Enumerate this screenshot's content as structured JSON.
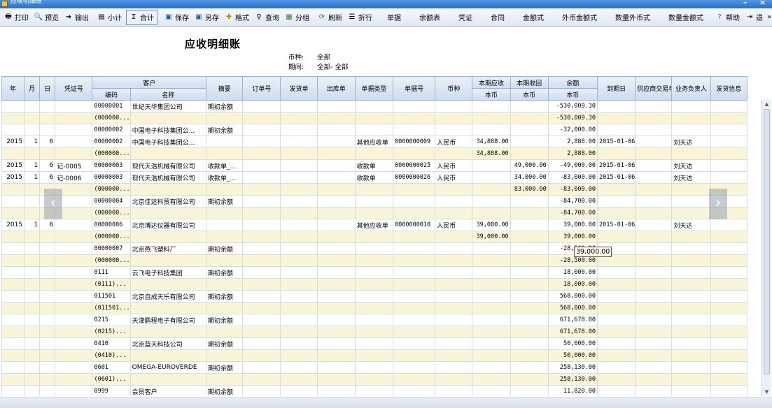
{
  "window": {
    "title": "应收明细账"
  },
  "toolbar": {
    "buttons": [
      {
        "label": "打印",
        "icon": "printer-icon"
      },
      {
        "label": "预览",
        "icon": "preview-icon"
      },
      {
        "label": "输出",
        "icon": "export-icon"
      },
      {
        "label": "小计",
        "icon": "subtotal-icon"
      },
      {
        "label": "合计",
        "icon": "sigma-icon"
      },
      {
        "label": "保存",
        "icon": "save-icon"
      },
      {
        "label": "另存",
        "icon": "save-as-icon"
      },
      {
        "label": "格式",
        "icon": "format-icon"
      },
      {
        "label": "查询",
        "icon": "binoculars-icon"
      },
      {
        "label": "分组",
        "icon": "group-icon"
      },
      {
        "label": "刷新",
        "icon": "refresh-icon"
      },
      {
        "label": "折行",
        "icon": "wrap-icon"
      },
      {
        "label": "单据"
      },
      {
        "label": "余额表"
      },
      {
        "label": "凭证"
      },
      {
        "label": "合同"
      },
      {
        "label": "金额式"
      },
      {
        "label": "外币金额式"
      },
      {
        "label": "数量外币式"
      },
      {
        "label": "数量金额式"
      },
      {
        "label": "帮助",
        "icon": "help-icon"
      },
      {
        "label": "退",
        "icon": "exit-icon"
      }
    ]
  },
  "report": {
    "title": "应收明细账",
    "currency_label": "币种:",
    "currency_value": "全部",
    "period_label": "期间:",
    "period_value": "全部- 全部"
  },
  "grid": {
    "headers": {
      "year": "年",
      "month": "月",
      "day": "日",
      "voucher": "凭证号",
      "customer": "客户",
      "code": "编码",
      "name": "名称",
      "summary": "摘要",
      "order": "订单号",
      "delivery": "发货单",
      "outbound": "出库单",
      "doc_type": "单据类型",
      "doc_no": "单据号",
      "currency": "币种",
      "receivable": "本期应收",
      "received": "本期收回",
      "balance": "余额",
      "base_currency": "本币",
      "due_date": "到期日",
      "supplier_doc": "供应商交易单号",
      "salesperson": "业务负责人",
      "shipping": "发货信息"
    },
    "rows": [
      {
        "sub": false,
        "y": "",
        "m": "",
        "d": "",
        "v": "",
        "code": "00000001",
        "name": "世纪天华集团公司",
        "sum": "期初余额",
        "dt": "",
        "dn": "",
        "cur": "",
        "rec": "",
        "rcv": "",
        "bal": "-530,009.30",
        "due": "",
        "sp": ""
      },
      {
        "sub": true,
        "y": "",
        "m": "",
        "d": "",
        "v": "",
        "code": "(000000...",
        "name": "",
        "sum": "",
        "dt": "",
        "dn": "",
        "cur": "",
        "rec": "",
        "rcv": "",
        "bal": "-530,009.30",
        "due": "",
        "sp": ""
      },
      {
        "sub": false,
        "y": "",
        "m": "",
        "d": "",
        "v": "",
        "code": "00000002",
        "name": "中国电子科技集团公...",
        "sum": "期初余额",
        "dt": "",
        "dn": "",
        "cur": "",
        "rec": "",
        "rcv": "",
        "bal": "-32,000.00",
        "due": "",
        "sp": ""
      },
      {
        "sub": false,
        "y": "2015",
        "m": "1",
        "d": "6",
        "v": "",
        "code": "00000002",
        "name": "中国电子科技集团公...",
        "sum": "",
        "dt": "其他应收单",
        "dn": "0000000009",
        "cur": "人民币",
        "rec": "34,888.00",
        "rcv": "",
        "bal": "2,888.00",
        "due": "2015-01-06",
        "sp": "刘天达"
      },
      {
        "sub": true,
        "y": "",
        "m": "",
        "d": "",
        "v": "",
        "code": "(000000...",
        "name": "",
        "sum": "",
        "dt": "",
        "dn": "",
        "cur": "",
        "rec": "34,888.00",
        "rcv": "",
        "bal": "2,888.00",
        "due": "",
        "sp": ""
      },
      {
        "sub": false,
        "y": "2015",
        "m": "1",
        "d": "6",
        "v": "记-0005",
        "code": "00000003",
        "name": "现代天浩机械有限公司",
        "sum": "收款单_...",
        "dt": "收款单",
        "dn": "0000000025",
        "cur": "人民币",
        "rec": "",
        "rcv": "49,000.00",
        "bal": "-49,000.00",
        "due": "2015-01-06",
        "sp": "刘天达"
      },
      {
        "sub": false,
        "y": "2015",
        "m": "1",
        "d": "6",
        "v": "记-0006",
        "code": "00000003",
        "name": "现代天浩机械有限公司",
        "sum": "收款单_...",
        "dt": "收款单",
        "dn": "0000000026",
        "cur": "人民币",
        "rec": "",
        "rcv": "34,000.00",
        "bal": "-83,000.00",
        "due": "2015-01-06",
        "sp": "刘天达"
      },
      {
        "sub": true,
        "y": "",
        "m": "",
        "d": "",
        "v": "",
        "code": "(000000...",
        "name": "",
        "sum": "",
        "dt": "",
        "dn": "",
        "cur": "",
        "rec": "",
        "rcv": "83,000.00",
        "bal": "-83,000.00",
        "due": "",
        "sp": ""
      },
      {
        "sub": false,
        "y": "",
        "m": "",
        "d": "",
        "v": "",
        "code": "00000004",
        "name": "北京佳运科贸有限公司",
        "sum": "期初余额",
        "dt": "",
        "dn": "",
        "cur": "",
        "rec": "",
        "rcv": "",
        "bal": "-84,700.00",
        "due": "",
        "sp": ""
      },
      {
        "sub": true,
        "y": "",
        "m": "",
        "d": "",
        "v": "",
        "code": "(000000...",
        "name": "",
        "sum": "",
        "dt": "",
        "dn": "",
        "cur": "",
        "rec": "",
        "rcv": "",
        "bal": "-84,700.00",
        "due": "",
        "sp": ""
      },
      {
        "sub": false,
        "y": "2015",
        "m": "1",
        "d": "6",
        "v": "",
        "code": "00000006",
        "name": "北京博达仪器有限公司",
        "sum": "",
        "dt": "其他应收单",
        "dn": "0000000010",
        "cur": "人民币",
        "rec": "39,000.00",
        "rcv": "",
        "bal": "39,000.00",
        "due": "2015-01-06",
        "sp": "刘天达"
      },
      {
        "sub": true,
        "y": "",
        "m": "",
        "d": "",
        "v": "",
        "code": "(000000...",
        "name": "",
        "sum": "",
        "dt": "",
        "dn": "",
        "cur": "",
        "rec": "39,000.00",
        "rcv": "",
        "bal": "39,000.00",
        "due": "",
        "sp": ""
      },
      {
        "sub": false,
        "y": "",
        "m": "",
        "d": "",
        "v": "",
        "code": "00000007",
        "name": "北京燕飞塑料厂",
        "sum": "期初余额",
        "dt": "",
        "dn": "",
        "cur": "",
        "rec": "",
        "rcv": "",
        "bal": "-28,500.00",
        "due": "",
        "sp": ""
      },
      {
        "sub": true,
        "y": "",
        "m": "",
        "d": "",
        "v": "",
        "code": "(000000...",
        "name": "",
        "sum": "",
        "dt": "",
        "dn": "",
        "cur": "",
        "rec": "",
        "rcv": "",
        "bal": "-28,500.00",
        "due": "",
        "sp": ""
      },
      {
        "sub": false,
        "y": "",
        "m": "",
        "d": "",
        "v": "",
        "code": "0111",
        "name": "云飞电子科技集团",
        "sum": "期初余额",
        "dt": "",
        "dn": "",
        "cur": "",
        "rec": "",
        "rcv": "",
        "bal": "18,000.00",
        "due": "",
        "sp": ""
      },
      {
        "sub": true,
        "y": "",
        "m": "",
        "d": "",
        "v": "",
        "code": "(0111)...",
        "name": "",
        "sum": "",
        "dt": "",
        "dn": "",
        "cur": "",
        "rec": "",
        "rcv": "",
        "bal": "18,000.00",
        "due": "",
        "sp": ""
      },
      {
        "sub": false,
        "y": "",
        "m": "",
        "d": "",
        "v": "",
        "code": "011501",
        "name": "北京自成天乐有限公司",
        "sum": "期初余额",
        "dt": "",
        "dn": "",
        "cur": "",
        "rec": "",
        "rcv": "",
        "bal": "568,000.00",
        "due": "",
        "sp": ""
      },
      {
        "sub": true,
        "y": "",
        "m": "",
        "d": "",
        "v": "",
        "code": "(011501...",
        "name": "",
        "sum": "",
        "dt": "",
        "dn": "",
        "cur": "",
        "rec": "",
        "rcv": "",
        "bal": "568,000.00",
        "due": "",
        "sp": ""
      },
      {
        "sub": false,
        "y": "",
        "m": "",
        "d": "",
        "v": "",
        "code": "0215",
        "name": "天津鹏程电子有限公司",
        "sum": "期初余额",
        "dt": "",
        "dn": "",
        "cur": "",
        "rec": "",
        "rcv": "",
        "bal": "671,678.00",
        "due": "",
        "sp": ""
      },
      {
        "sub": true,
        "y": "",
        "m": "",
        "d": "",
        "v": "",
        "code": "(0215)...",
        "name": "",
        "sum": "",
        "dt": "",
        "dn": "",
        "cur": "",
        "rec": "",
        "rcv": "",
        "bal": "671,678.00",
        "due": "",
        "sp": ""
      },
      {
        "sub": false,
        "y": "",
        "m": "",
        "d": "",
        "v": "",
        "code": "0410",
        "name": "北京蓝天科技公司",
        "sum": "期初余额",
        "dt": "",
        "dn": "",
        "cur": "",
        "rec": "",
        "rcv": "",
        "bal": "50,000.00",
        "due": "",
        "sp": ""
      },
      {
        "sub": true,
        "y": "",
        "m": "",
        "d": "",
        "v": "",
        "code": "(0410)...",
        "name": "",
        "sum": "",
        "dt": "",
        "dn": "",
        "cur": "",
        "rec": "",
        "rcv": "",
        "bal": "50,000.00",
        "due": "",
        "sp": ""
      },
      {
        "sub": false,
        "y": "",
        "m": "",
        "d": "",
        "v": "",
        "code": "0601",
        "name": "OMEGA-EUROVERDE",
        "sum": "期初余额",
        "dt": "",
        "dn": "",
        "cur": "",
        "rec": "",
        "rcv": "",
        "bal": "258,130.00",
        "due": "",
        "sp": ""
      },
      {
        "sub": true,
        "y": "",
        "m": "",
        "d": "",
        "v": "",
        "code": "(0601)...",
        "name": "",
        "sum": "",
        "dt": "",
        "dn": "",
        "cur": "",
        "rec": "",
        "rcv": "",
        "bal": "258,130.00",
        "due": "",
        "sp": ""
      },
      {
        "sub": false,
        "y": "",
        "m": "",
        "d": "",
        "v": "",
        "code": "0999",
        "name": "会员客户",
        "sum": "期初余额",
        "dt": "",
        "dn": "",
        "cur": "",
        "rec": "",
        "rcv": "",
        "bal": "11,820.00",
        "due": "",
        "sp": ""
      }
    ]
  },
  "tooltip": {
    "text": "39,000.00"
  },
  "nav": {
    "prev_glyph": "‹",
    "next_glyph": "›"
  },
  "icons": {
    "window_minimize": "minimize-icon",
    "window_close": "close-icon",
    "more": "chevron-right-icon"
  }
}
